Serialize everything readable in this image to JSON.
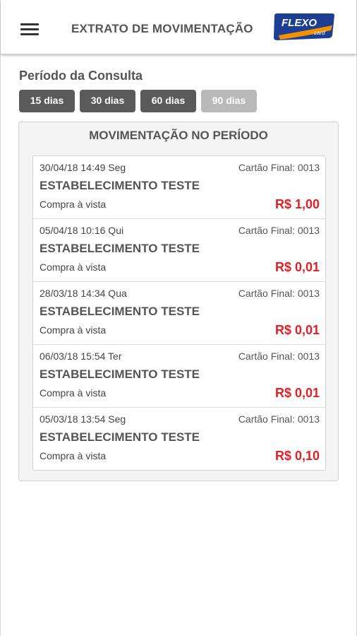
{
  "header": {
    "title": "EXTRATO DE MOVIMENTAÇÃO",
    "logo_text_main": "FLEXO",
    "logo_text_sub": "card"
  },
  "colors": {
    "amount": "#e21f26",
    "button_default": "#5a5a5a",
    "button_active": "#b9b9b9",
    "logo_blue": "#1c3f94",
    "logo_orange": "#f39200"
  },
  "period": {
    "label": "Período da Consulta",
    "buttons": [
      {
        "label": "15 dias",
        "active": false
      },
      {
        "label": "30 dias",
        "active": false
      },
      {
        "label": "60 dias",
        "active": false
      },
      {
        "label": "90 dias",
        "active": true
      }
    ]
  },
  "movements": {
    "title": "MOVIMENTAÇÃO NO PERÍODO",
    "items": [
      {
        "date": "30/04/18 14:49 Seg",
        "card": "Cartão Final: 0013",
        "merchant": "ESTABELECIMENTO TESTE",
        "type": "Compra à vista",
        "amount": "R$ 1,00"
      },
      {
        "date": "05/04/18 10:16 Qui",
        "card": "Cartão Final: 0013",
        "merchant": "ESTABELECIMENTO TESTE",
        "type": "Compra à vista",
        "amount": "R$ 0,01"
      },
      {
        "date": "28/03/18 14:34 Qua",
        "card": "Cartão Final: 0013",
        "merchant": "ESTABELECIMENTO TESTE",
        "type": "Compra à vista",
        "amount": "R$ 0,01"
      },
      {
        "date": "06/03/18 15:54 Ter",
        "card": "Cartão Final: 0013",
        "merchant": "ESTABELECIMENTO TESTE",
        "type": "Compra à vista",
        "amount": "R$ 0,01"
      },
      {
        "date": "05/03/18 13:54 Seg",
        "card": "Cartão Final: 0013",
        "merchant": "ESTABELECIMENTO TESTE",
        "type": "Compra à vista",
        "amount": "R$ 0,10"
      }
    ]
  }
}
